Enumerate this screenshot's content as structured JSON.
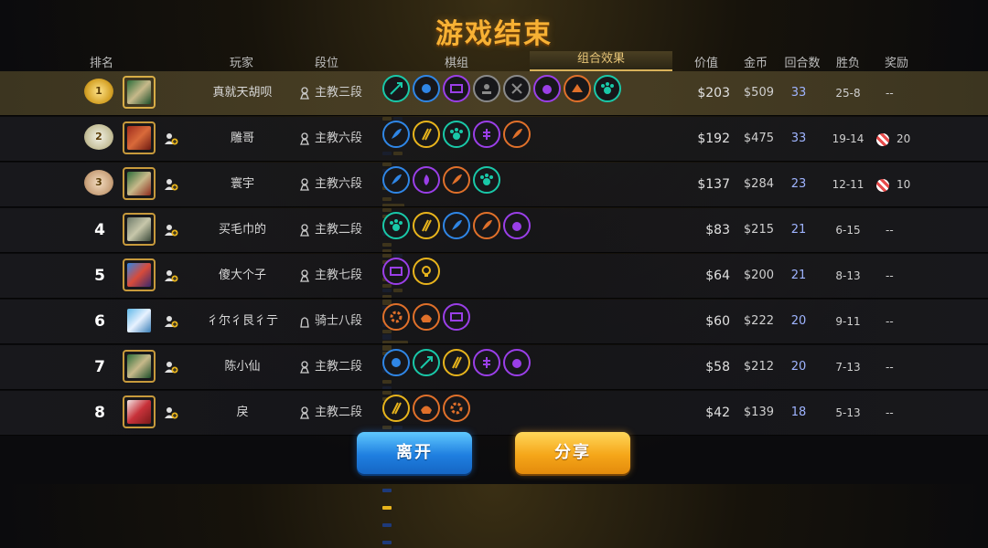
{
  "title": "游戏结束",
  "headers": {
    "rank": "排名",
    "player": "玩家",
    "tier": "段位",
    "lineup": "棋组",
    "combo": "组合效果",
    "value": "价值",
    "gold": "金币",
    "rounds": "回合数",
    "winloss": "胜负",
    "reward": "奖励"
  },
  "rows": [
    {
      "rank": "1",
      "player": "真就天胡呗",
      "tier": "主教三段",
      "value": "$203",
      "gold": "$509",
      "rounds": "33",
      "wl": "25-8",
      "reward": "--"
    },
    {
      "rank": "2",
      "player": "雕哥",
      "tier": "主教六段",
      "value": "$192",
      "gold": "$475",
      "rounds": "33",
      "wl": "19-14",
      "reward": "20"
    },
    {
      "rank": "3",
      "player": "寰宇",
      "tier": "主教六段",
      "value": "$137",
      "gold": "$284",
      "rounds": "23",
      "wl": "12-11",
      "reward": "10"
    },
    {
      "rank": "4",
      "player": "买毛巾的",
      "tier": "主教二段",
      "value": "$83",
      "gold": "$215",
      "rounds": "21",
      "wl": "6-15",
      "reward": "--"
    },
    {
      "rank": "5",
      "player": "傻大个子",
      "tier": "主教七段",
      "value": "$64",
      "gold": "$200",
      "rounds": "21",
      "wl": "8-13",
      "reward": "--"
    },
    {
      "rank": "6",
      "player": "彳尔彳艮彳亍",
      "tier": "骑士八段",
      "value": "$60",
      "gold": "$222",
      "rounds": "20",
      "wl": "9-11",
      "reward": "--"
    },
    {
      "rank": "7",
      "player": "陈小仙",
      "tier": "主教二段",
      "value": "$58",
      "gold": "$212",
      "rounds": "20",
      "wl": "7-13",
      "reward": "--"
    },
    {
      "rank": "8",
      "player": "戾",
      "tier": "主教二段",
      "value": "$42",
      "gold": "$139",
      "rounds": "18",
      "wl": "5-13",
      "reward": "--"
    }
  ],
  "buttons": {
    "leave": "离开",
    "share": "分享"
  },
  "colors": {
    "title": "#f7b134",
    "gold_trait": "#e8b41c",
    "teal_trait": "#19c8a8",
    "blue_trait": "#2f86e6",
    "purple_trait": "#9a3fe8",
    "orange_trait": "#e0702a",
    "gray_trait": "#8a8a8a"
  }
}
